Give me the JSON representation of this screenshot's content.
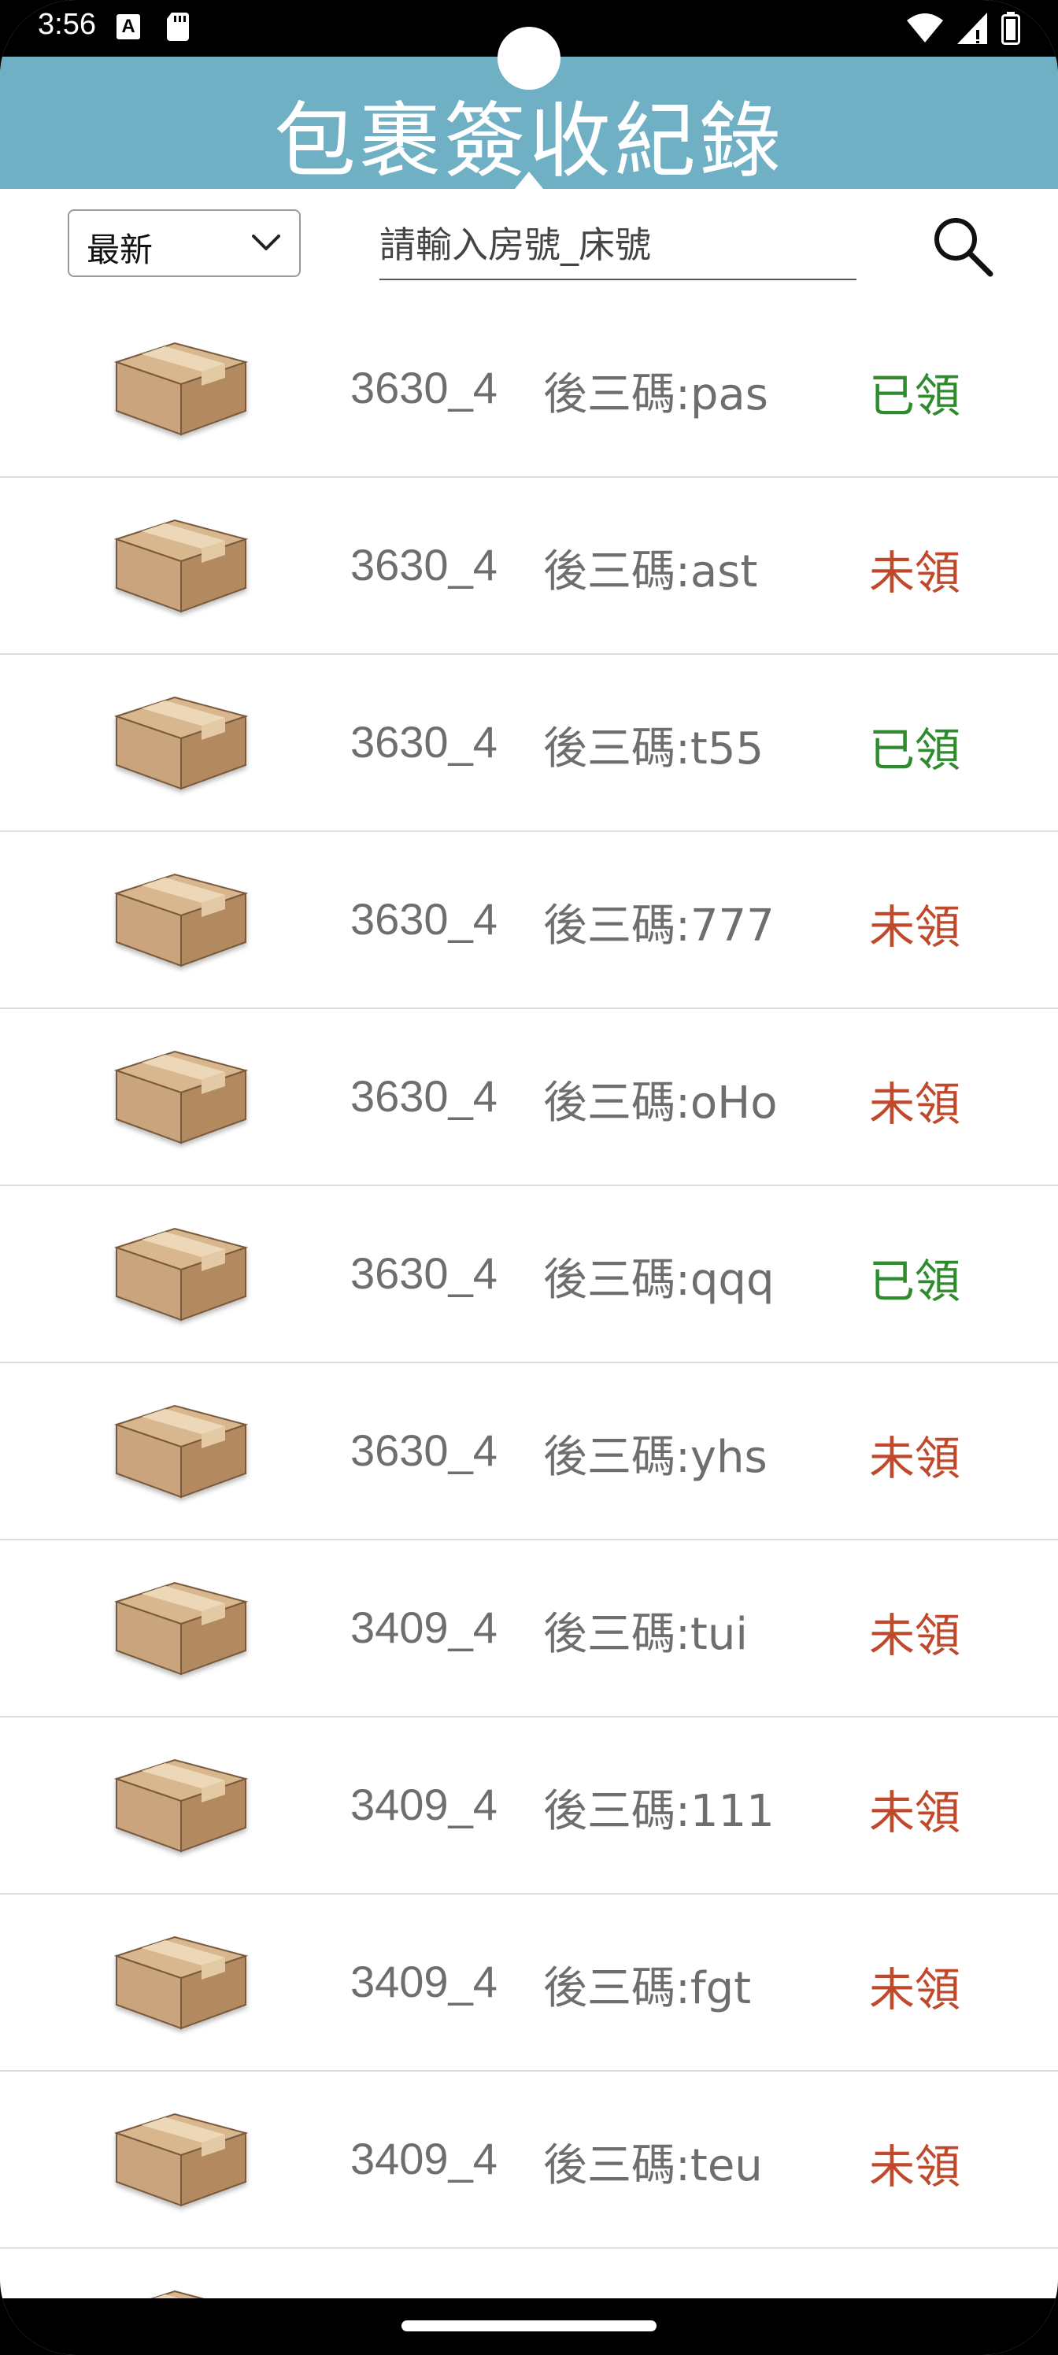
{
  "status_bar": {
    "time": "3:56",
    "notification_icon_letter": "A",
    "icons": [
      "a-notification-icon",
      "sd-card-icon",
      "wifi-icon",
      "signal-icon",
      "battery-icon"
    ]
  },
  "header": {
    "title": "包裹簽收紀錄",
    "background_color": "#6fb0c4"
  },
  "toolbar": {
    "sort_selected": "最新",
    "search_placeholder": "請輸入房號_床號",
    "search_value": ""
  },
  "colors": {
    "claimed": "#2e8b2e",
    "unclaimed": "#c0492c",
    "text": "#6e6e6e"
  },
  "packages": [
    {
      "room": "3630_4",
      "code": "後三碼:pas",
      "status": "已領",
      "claimed": true
    },
    {
      "room": "3630_4",
      "code": "後三碼:ast",
      "status": "未領",
      "claimed": false
    },
    {
      "room": "3630_4",
      "code": "後三碼:t55",
      "status": "已領",
      "claimed": true
    },
    {
      "room": "3630_4",
      "code": "後三碼:777",
      "status": "未領",
      "claimed": false
    },
    {
      "room": "3630_4",
      "code": "後三碼:oHo",
      "status": "未領",
      "claimed": false
    },
    {
      "room": "3630_4",
      "code": "後三碼:qqq",
      "status": "已領",
      "claimed": true
    },
    {
      "room": "3630_4",
      "code": "後三碼:yhs",
      "status": "未領",
      "claimed": false
    },
    {
      "room": "3409_4",
      "code": "後三碼:tui",
      "status": "未領",
      "claimed": false
    },
    {
      "room": "3409_4",
      "code": "後三碼:111",
      "status": "未領",
      "claimed": false
    },
    {
      "room": "3409_4",
      "code": "後三碼:fgt",
      "status": "未領",
      "claimed": false
    },
    {
      "room": "3409_4",
      "code": "後三碼:teu",
      "status": "未領",
      "claimed": false
    }
  ]
}
